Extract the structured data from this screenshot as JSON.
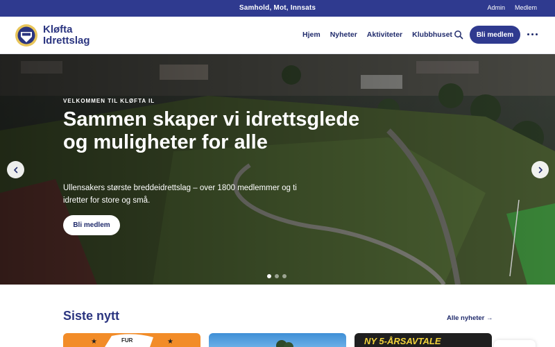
{
  "topbar": {
    "slogan": "Samhold, Mot, Innsats",
    "links": [
      "Admin",
      "Medlem"
    ]
  },
  "header": {
    "brand_line1": "Kløfta",
    "brand_line2": "Idrettslag",
    "nav": [
      "Hjem",
      "Nyheter",
      "Aktiviteter",
      "Klubbhuset"
    ],
    "cta_label": "Bli medlem",
    "icons": {
      "search": "search-icon",
      "more": "more-dots-icon",
      "logo": "club-crest-logo"
    }
  },
  "hero": {
    "eyebrow": "VELKOMMEN TIL KLØFTA IL",
    "headline": "Sammen skaper vi idrettsglede og muligheter for alle",
    "subtitle": "Ullensakers største breddeidrettslag – over 1800 medlemmer og ti idretter for store og små.",
    "cta_label": "Bli medlem",
    "slides_total": 3,
    "active_slide": 1
  },
  "news": {
    "title": "Siste nytt",
    "all_link": "Alle nyheter →",
    "card_texts": [
      "FUR",
      "NY 5-ÅRSAVTALE"
    ]
  },
  "colors": {
    "brand": "#2f3a8f",
    "text_dark": "#1f2a6b",
    "card_orange": "#f28c28"
  }
}
